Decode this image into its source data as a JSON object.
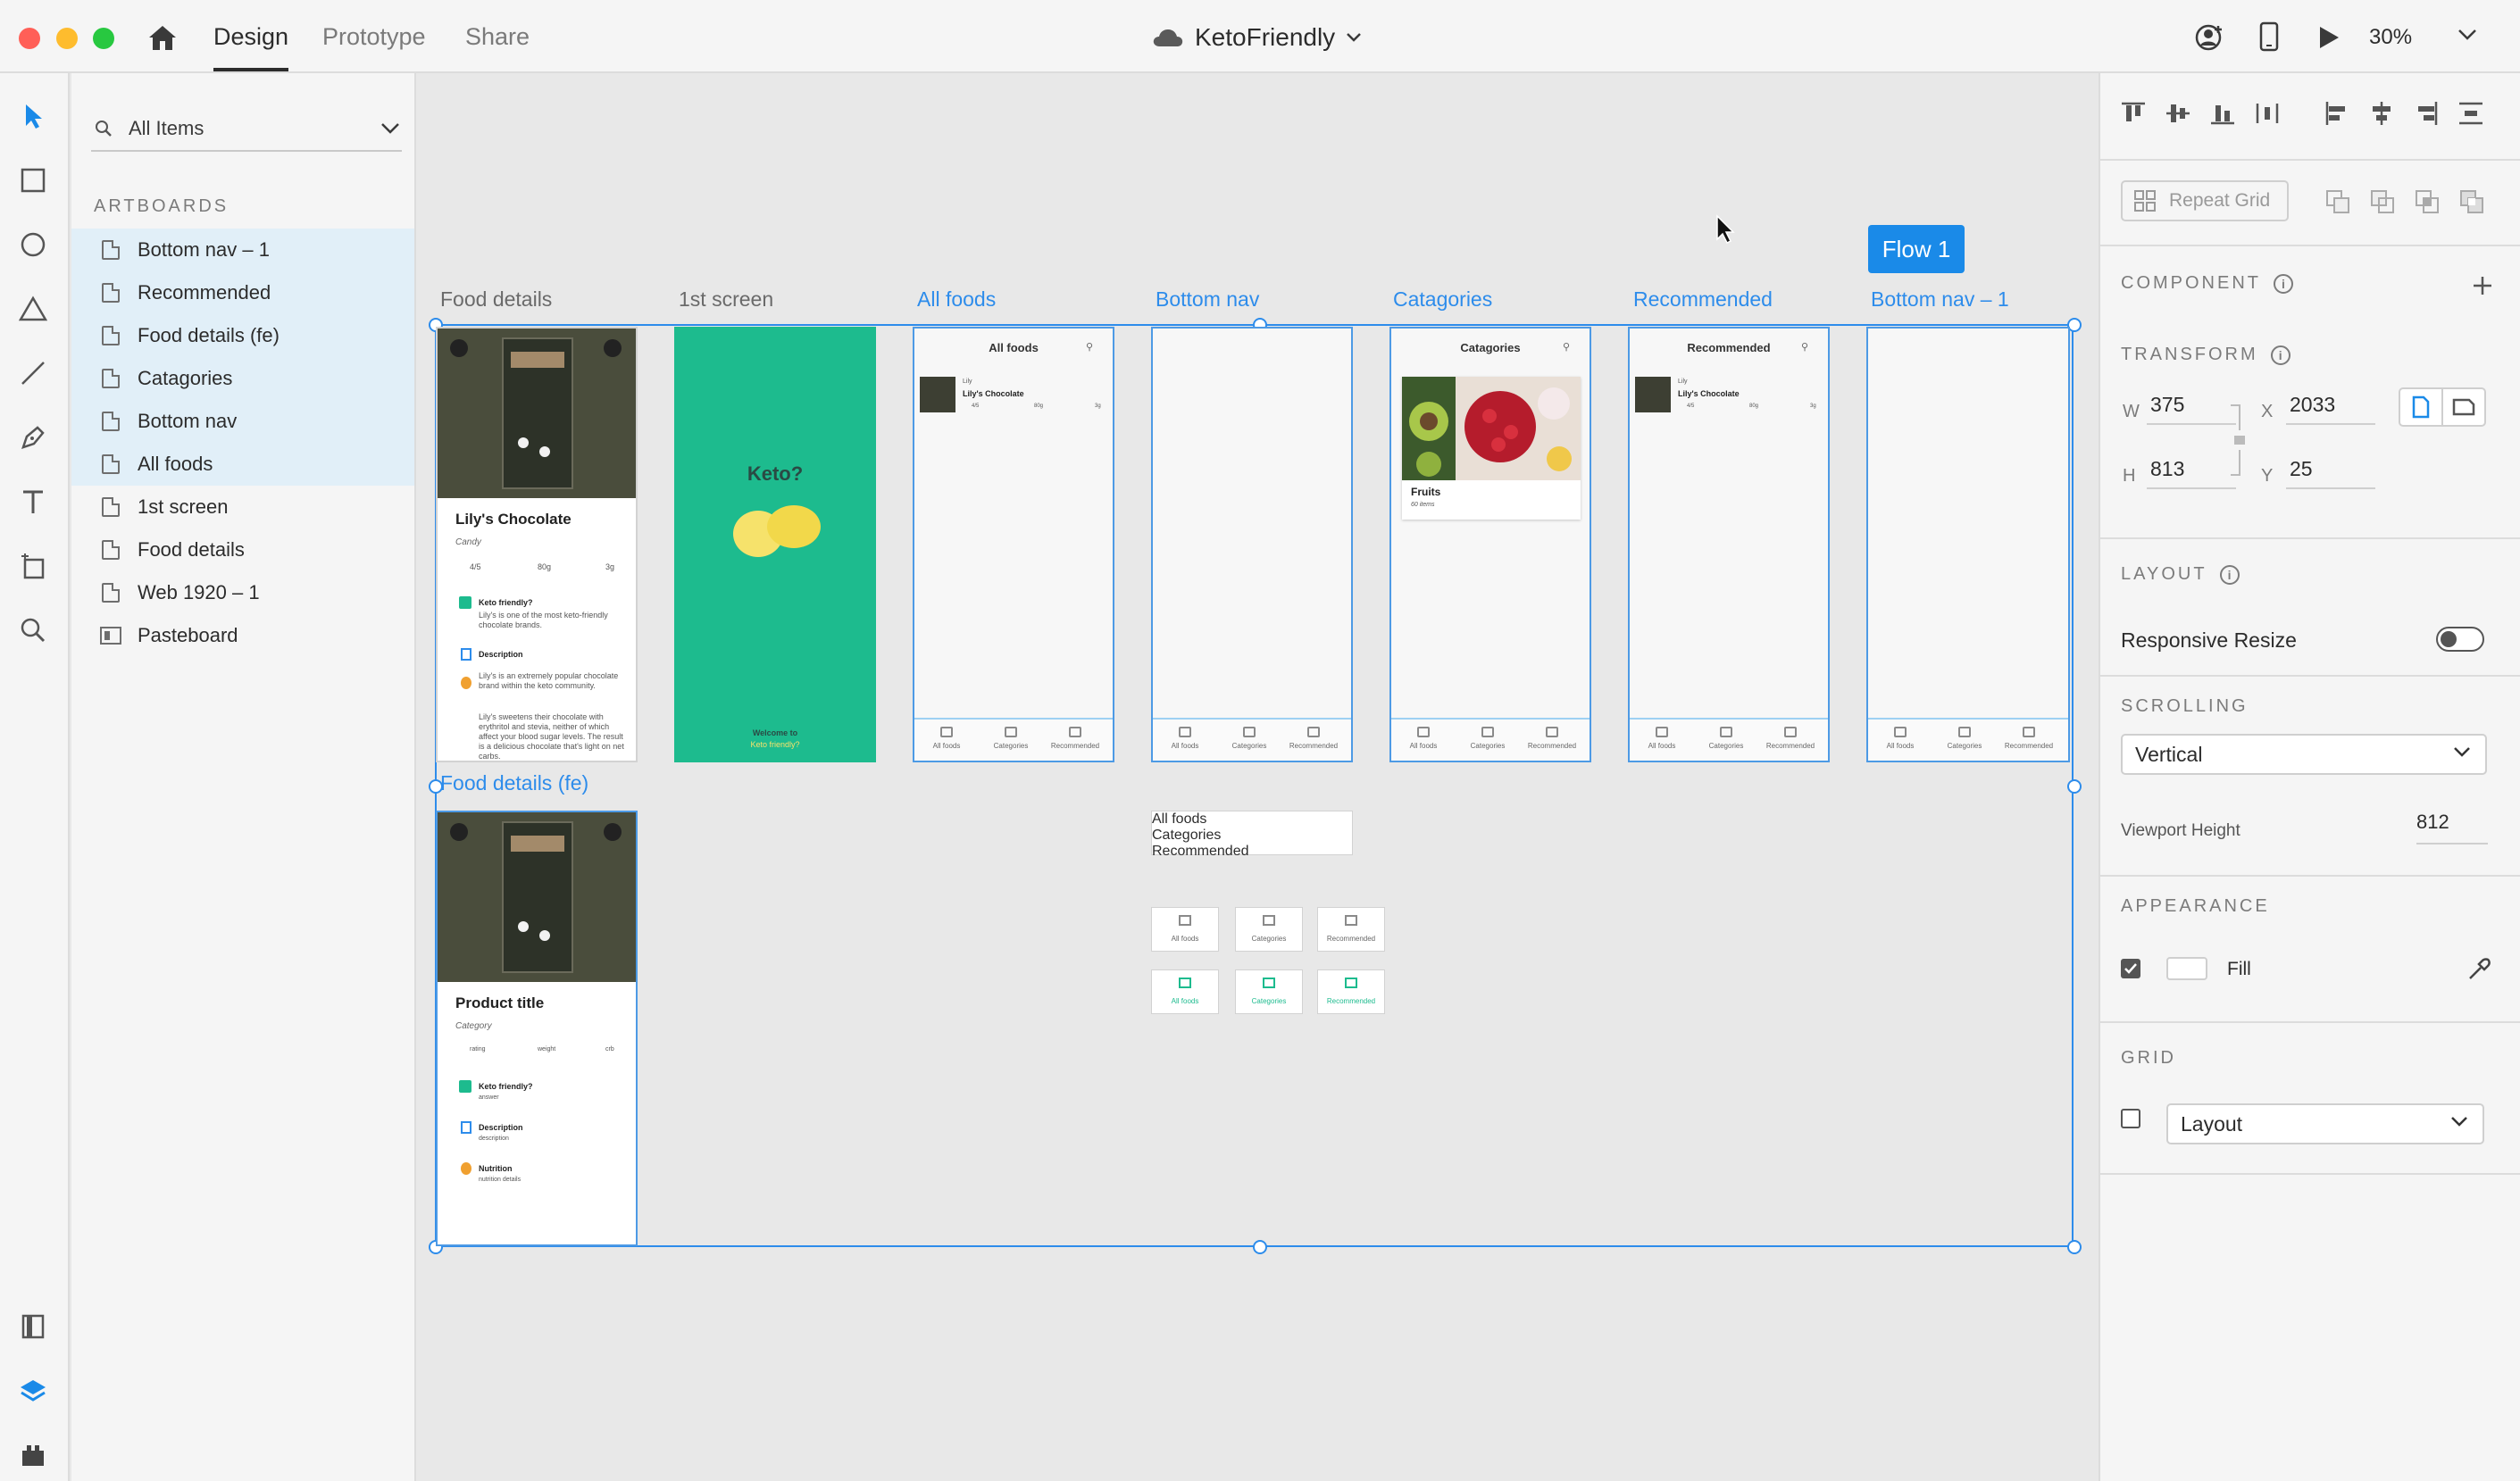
{
  "topbar": {
    "tabs": [
      "Design",
      "Prototype",
      "Share"
    ],
    "doc_title": "KetoFriendly",
    "zoom": "30%"
  },
  "layers": {
    "search_placeholder": "All Items",
    "section_title": "ARTBOARDS",
    "items": [
      {
        "label": "Bottom nav – 1",
        "selected": true
      },
      {
        "label": "Recommended",
        "selected": true
      },
      {
        "label": "Food details (fe)",
        "selected": true
      },
      {
        "label": "Catagories",
        "selected": true
      },
      {
        "label": "Bottom nav",
        "selected": true
      },
      {
        "label": "All foods",
        "selected": true
      },
      {
        "label": "1st screen",
        "selected": false
      },
      {
        "label": "Food details",
        "selected": false
      },
      {
        "label": "Web 1920 – 1",
        "selected": false
      },
      {
        "label": "Pasteboard",
        "selected": false
      }
    ]
  },
  "canvas": {
    "flow_label": "Flow 1",
    "artboard_labels": [
      "Food details",
      "1st screen",
      "All foods",
      "Bottom nav",
      "Catagories",
      "Recommended",
      "Bottom nav – 1",
      "Food details (fe)"
    ],
    "food_details": {
      "title": "Lily's Chocolate",
      "category": "Candy",
      "stats": [
        "4/5",
        "80g",
        "3g"
      ],
      "q1": "Keto friendly?",
      "a1": "Lily's is one of the most keto-friendly chocolate brands.",
      "q2": "Description",
      "d1": "Lily's is an extremely popular chocolate brand within the keto community.",
      "d2": "Lily's sweetens their chocolate with erythritol and stevia, neither of which affect your blood sugar levels. The result is a delicious chocolate that's light on net carbs."
    },
    "first_screen": {
      "heading": "Keto?",
      "welcome": "Welcome to",
      "brand": "Keto friendly?"
    },
    "all_foods": {
      "header": "All foods",
      "item_sub": "Lily",
      "item_title": "Lily's Chocolate",
      "item_stats": [
        "4/5",
        "80g",
        "3g"
      ]
    },
    "catagories": {
      "header": "Catagories",
      "card_title": "Fruits",
      "card_sub": "60 items"
    },
    "recommended": {
      "header": "Recommended",
      "item_sub": "Lily",
      "item_title": "Lily's Chocolate",
      "item_stats": [
        "4/5",
        "80g",
        "3g"
      ]
    },
    "nav_labels": [
      "All foods",
      "Categories",
      "Recommended"
    ],
    "food_details_fe": {
      "title": "Product title",
      "category": "Category",
      "stats": [
        "rating",
        "weight",
        "crb"
      ],
      "q1": "Keto friendly?",
      "a1": "answer",
      "q2": "Description",
      "a2": "description",
      "q3": "Nutrition",
      "a3": "nutrition details"
    }
  },
  "props": {
    "repeat_grid": "Repeat Grid",
    "component_title": "COMPONENT",
    "transform_title": "TRANSFORM",
    "w_label": "W",
    "w": "375",
    "h_label": "H",
    "h": "813",
    "x_label": "X",
    "x": "2033",
    "y_label": "Y",
    "y": "25",
    "layout_title": "LAYOUT",
    "responsive_resize": "Responsive Resize",
    "scrolling_title": "SCROLLING",
    "scrolling_value": "Vertical",
    "viewport_label": "Viewport Height",
    "viewport_value": "812",
    "appearance_title": "APPEARANCE",
    "fill_label": "Fill",
    "grid_title": "GRID",
    "grid_value": "Layout"
  },
  "colors": {
    "accent": "#2d8ceb",
    "keto_green": "#1dbb8e",
    "selection_bg": "#e1eff8"
  }
}
